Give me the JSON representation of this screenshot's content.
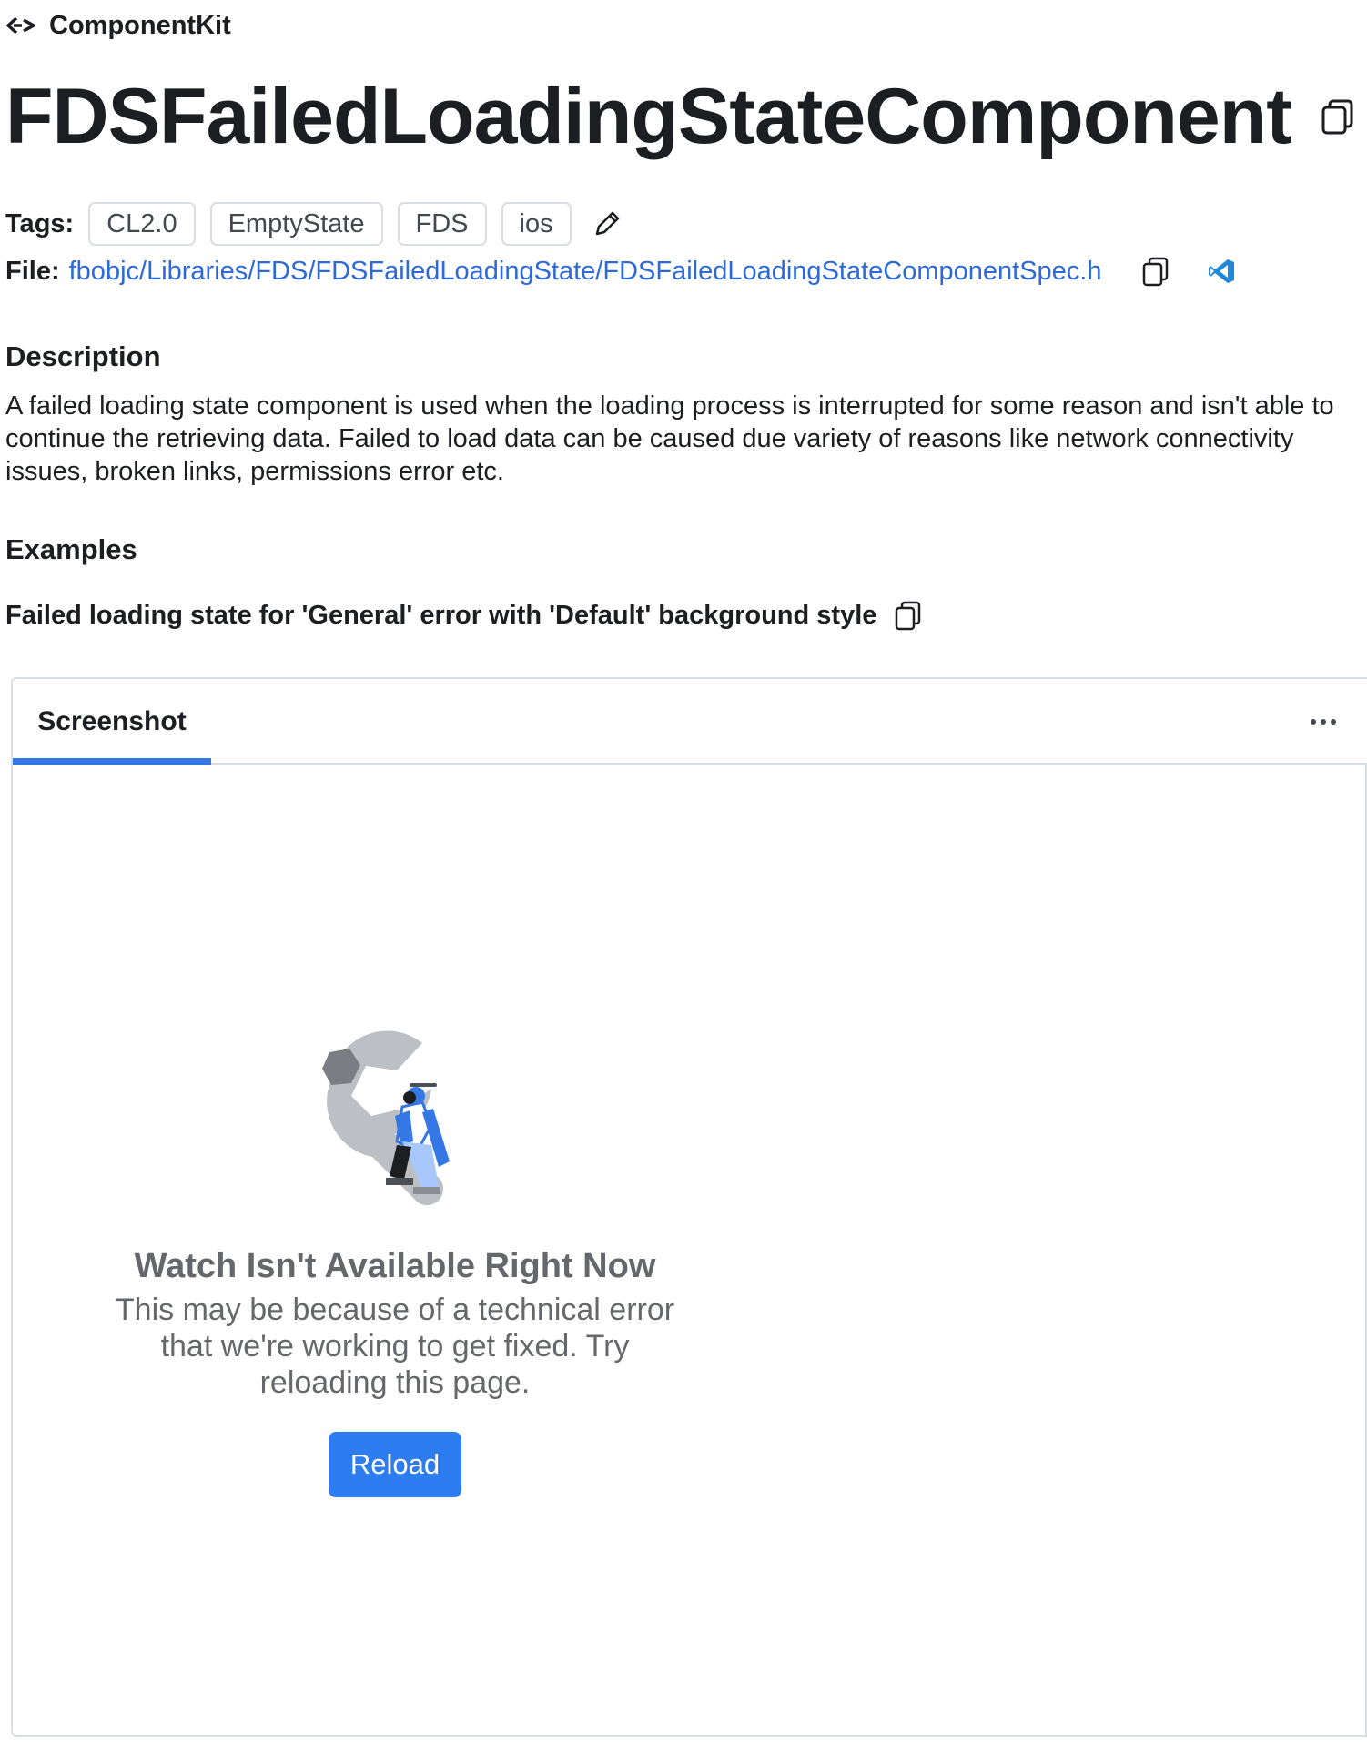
{
  "breadcrumb": {
    "label": "ComponentKit"
  },
  "page": {
    "title": "FDSFailedLoadingStateComponent"
  },
  "tags": {
    "label": "Tags:",
    "items": [
      "CL2.0",
      "EmptyState",
      "FDS",
      "ios"
    ]
  },
  "file": {
    "label": "File:",
    "path": "fbobjc/Libraries/FDS/FDSFailedLoadingState/FDSFailedLoadingStateComponentSpec.h"
  },
  "description": {
    "heading": "Description",
    "text": "A failed loading state component is used when the loading process is interrupted for some reason and isn't able to continue the retrieving data. Failed to load data can be caused due variety of reasons like network connectivity issues, broken links, permissions error etc."
  },
  "examples": {
    "heading": "Examples",
    "example_title": "Failed loading state for 'General' error with 'Default' background style"
  },
  "panel": {
    "tab_label": "Screenshot"
  },
  "empty_state": {
    "title": "Watch Isn't Available Right Now",
    "body": "This may be because of a technical error that we're working to get fixed. Try reloading this page.",
    "button_label": "Reload"
  },
  "colors": {
    "link": "#2d6ad7",
    "accent": "#3578e5",
    "button": "#2d7cf0",
    "muted_text": "#65676b"
  },
  "icons": [
    "componentkit-logo-icon",
    "copy-icon",
    "pencil-icon",
    "vscode-icon",
    "more-dots-icon"
  ]
}
